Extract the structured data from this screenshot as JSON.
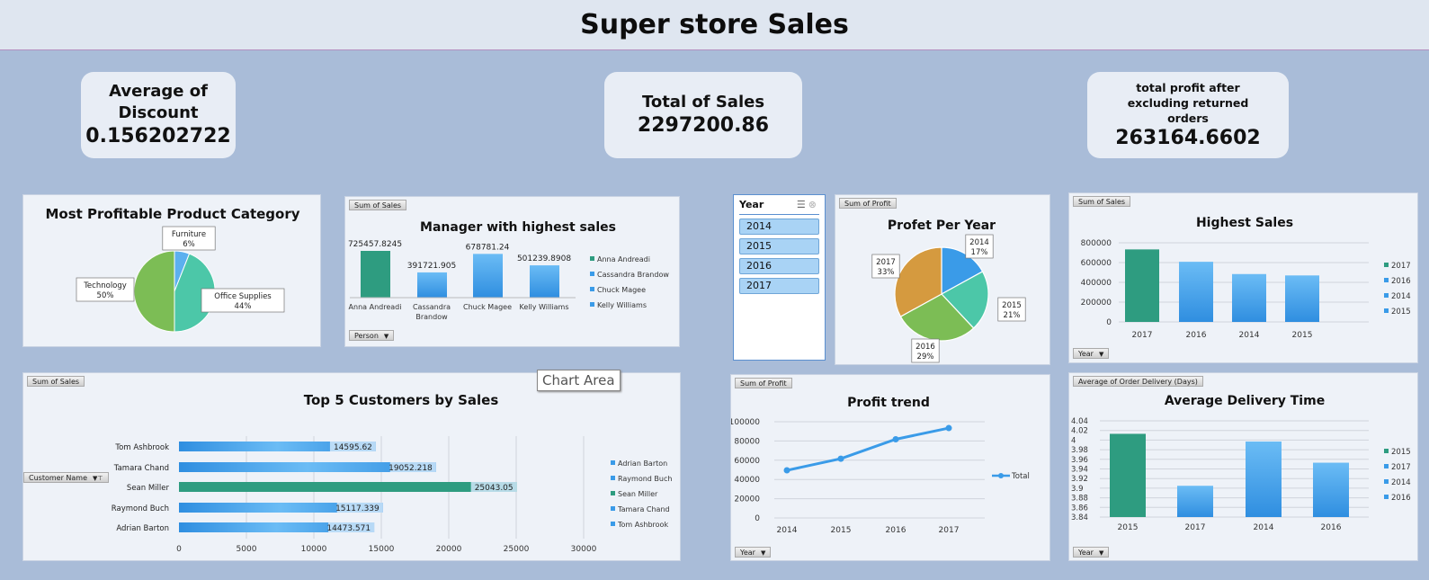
{
  "title": "Super store Sales",
  "kpis": {
    "discount_label": "Average of Discount",
    "discount_value": "0.156202722",
    "sales_label": "Total of Sales",
    "sales_value": "2297200.86",
    "profit_label": "total profit after excluding returned orders",
    "profit_value": "263164.6602"
  },
  "colors": {
    "green": "#2e9c80",
    "blue": "#3a9be8",
    "lightblue": "#5cb0ef",
    "bg": "#a9bcd8"
  },
  "tooltip": "Chart Area",
  "slicer": {
    "title": "Year",
    "items": [
      "2014",
      "2015",
      "2016",
      "2017"
    ]
  },
  "charts": {
    "category_pie": {
      "title": "Most Profitable Product Category",
      "slices": [
        {
          "name": "Furniture",
          "pct": "6%"
        },
        {
          "name": "Office Supplies",
          "pct": "44%"
        },
        {
          "name": "Technology",
          "pct": "50%"
        }
      ]
    },
    "manager": {
      "title": "Manager with highest sales",
      "field": "Sum of Sales",
      "filter": "Person",
      "value_labels": [
        "725457.8245",
        "391721.905",
        "678781.24",
        "501239.8908"
      ],
      "cat_labels": [
        "Anna Andreadi",
        "Cassandra",
        "Brandow",
        "Chuck Magee",
        "Kelly Williams"
      ],
      "legend": [
        "Anna Andreadi",
        "Cassandra Brandow",
        "Chuck Magee",
        "Kelly Williams"
      ]
    },
    "top5": {
      "title": "Top 5 Customers by Sales",
      "field": "Sum of Sales",
      "filter": "Customer Name",
      "value_labels": [
        "14595.62",
        "19052.218",
        "25043.05",
        "15117.339",
        "14473.571"
      ],
      "categories": [
        "Tom Ashbrook",
        "Tamara Chand",
        "Sean Miller",
        "Raymond Buch",
        "Adrian Barton"
      ],
      "ticks": [
        "0",
        "5000",
        "10000",
        "15000",
        "20000",
        "25000",
        "30000"
      ],
      "legend": [
        "Adrian Barton",
        "Raymond Buch",
        "Sean Miller",
        "Tamara Chand",
        "Tom Ashbrook"
      ]
    },
    "profit_pie": {
      "title": "Profet Per Year",
      "field": "Sum of Profit",
      "labels": [
        {
          "year": "2014",
          "pct": "17%"
        },
        {
          "year": "2015",
          "pct": "21%"
        },
        {
          "year": "2016",
          "pct": "29%"
        },
        {
          "year": "2017",
          "pct": "33%"
        }
      ]
    },
    "highest_sales": {
      "title": "Highest Sales",
      "field": "Sum of Sales",
      "filter": "Year",
      "categories": [
        "2017",
        "2016",
        "2014",
        "2015"
      ],
      "ticks": [
        "800000",
        "600000",
        "400000",
        "200000",
        "0"
      ],
      "legend": [
        "2017",
        "2016",
        "2014",
        "2015"
      ]
    },
    "profit_trend": {
      "title": "Profit trend",
      "field": "Sum of Profit",
      "filter": "Year",
      "categories": [
        "2014",
        "2015",
        "2016",
        "2017"
      ],
      "ticks": [
        "100000",
        "80000",
        "60000",
        "40000",
        "20000",
        "0"
      ],
      "legend": "Total"
    },
    "delivery": {
      "title": "Average Delivery Time",
      "field": "Average of Order Delivery (Days)",
      "filter": "Year",
      "categories": [
        "2015",
        "2017",
        "2014",
        "2016"
      ],
      "ticks": [
        "4.04",
        "4.02",
        "4",
        "3.98",
        "3.96",
        "3.94",
        "3.92",
        "3.9",
        "3.88",
        "3.86",
        "3.84"
      ],
      "legend": [
        "2015",
        "2017",
        "2014",
        "2016"
      ]
    }
  },
  "chart_data": [
    {
      "type": "pie",
      "title": "Most Profitable Product Category",
      "categories": [
        "Furniture",
        "Office Supplies",
        "Technology"
      ],
      "values": [
        6,
        44,
        50
      ]
    },
    {
      "type": "bar",
      "title": "Manager with highest sales",
      "categories": [
        "Anna Andreadi",
        "Cassandra Brandow",
        "Chuck Magee",
        "Kelly Williams"
      ],
      "values": [
        725457.8245,
        391721.905,
        678781.24,
        501239.8908
      ]
    },
    {
      "type": "bar",
      "title": "Top 5 Customers by Sales",
      "categories": [
        "Tom Ashbrook",
        "Tamara Chand",
        "Sean Miller",
        "Raymond Buch",
        "Adrian Barton"
      ],
      "values": [
        14595.62,
        19052.218,
        25043.05,
        15117.339,
        14473.571
      ],
      "xlim": [
        0,
        30000
      ]
    },
    {
      "type": "pie",
      "title": "Profet Per Year",
      "categories": [
        "2014",
        "2015",
        "2016",
        "2017"
      ],
      "values": [
        17,
        21,
        29,
        33
      ]
    },
    {
      "type": "bar",
      "title": "Highest Sales",
      "categories": [
        "2017",
        "2016",
        "2014",
        "2015"
      ],
      "values": [
        733000,
        608000,
        484000,
        470000
      ],
      "ylim": [
        0,
        800000
      ]
    },
    {
      "type": "line",
      "title": "Profit trend",
      "categories": [
        "2014",
        "2015",
        "2016",
        "2017"
      ],
      "values": [
        49500,
        61600,
        81800,
        93400
      ],
      "ylim": [
        0,
        100000
      ]
    },
    {
      "type": "bar",
      "title": "Average Delivery Time",
      "categories": [
        "2015",
        "2017",
        "2014",
        "2016"
      ],
      "values": [
        4.013,
        3.905,
        3.997,
        3.953
      ],
      "ylim": [
        3.84,
        4.04
      ]
    }
  ]
}
